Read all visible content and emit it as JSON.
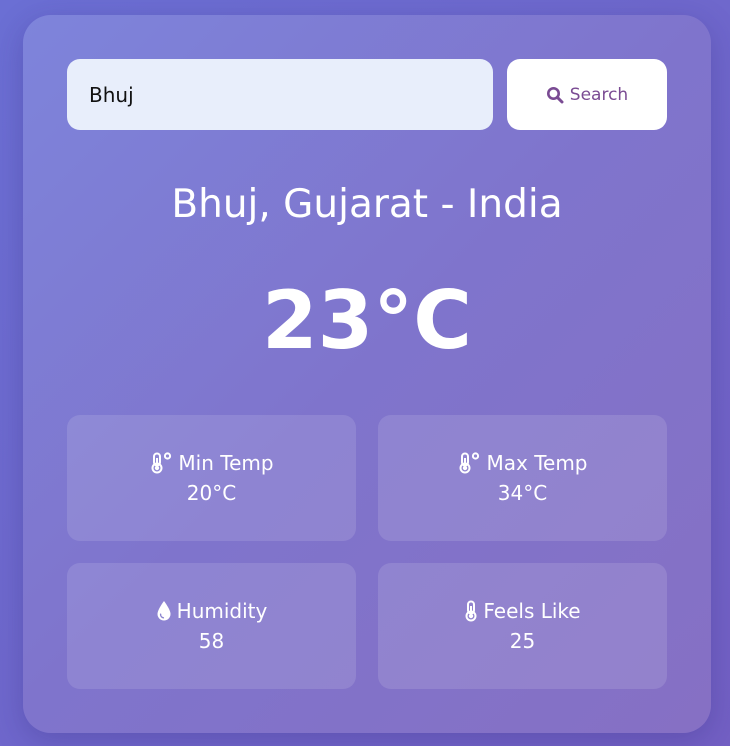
{
  "search": {
    "value": "Bhuj",
    "button_label": "Search",
    "icon": "search-icon"
  },
  "weather": {
    "location": "Bhuj, Gujarat - India",
    "temperature": "23°C"
  },
  "stats": {
    "min_temp": {
      "label": "Min Temp",
      "value": "20°C",
      "icon": "thermometer-degree-icon"
    },
    "max_temp": {
      "label": "Max Temp",
      "value": "34°C",
      "icon": "thermometer-degree-icon"
    },
    "humidity": {
      "label": "Humidity",
      "value": "58",
      "icon": "droplet-icon"
    },
    "feels_like": {
      "label": "Feels Like",
      "value": "25",
      "icon": "thermometer-icon"
    }
  },
  "colors": {
    "background": "#6b6fd4",
    "card": "#7f7ad1",
    "input_background": "#e8eefb",
    "button_text": "#7a4b93",
    "text": "#ffffff"
  }
}
